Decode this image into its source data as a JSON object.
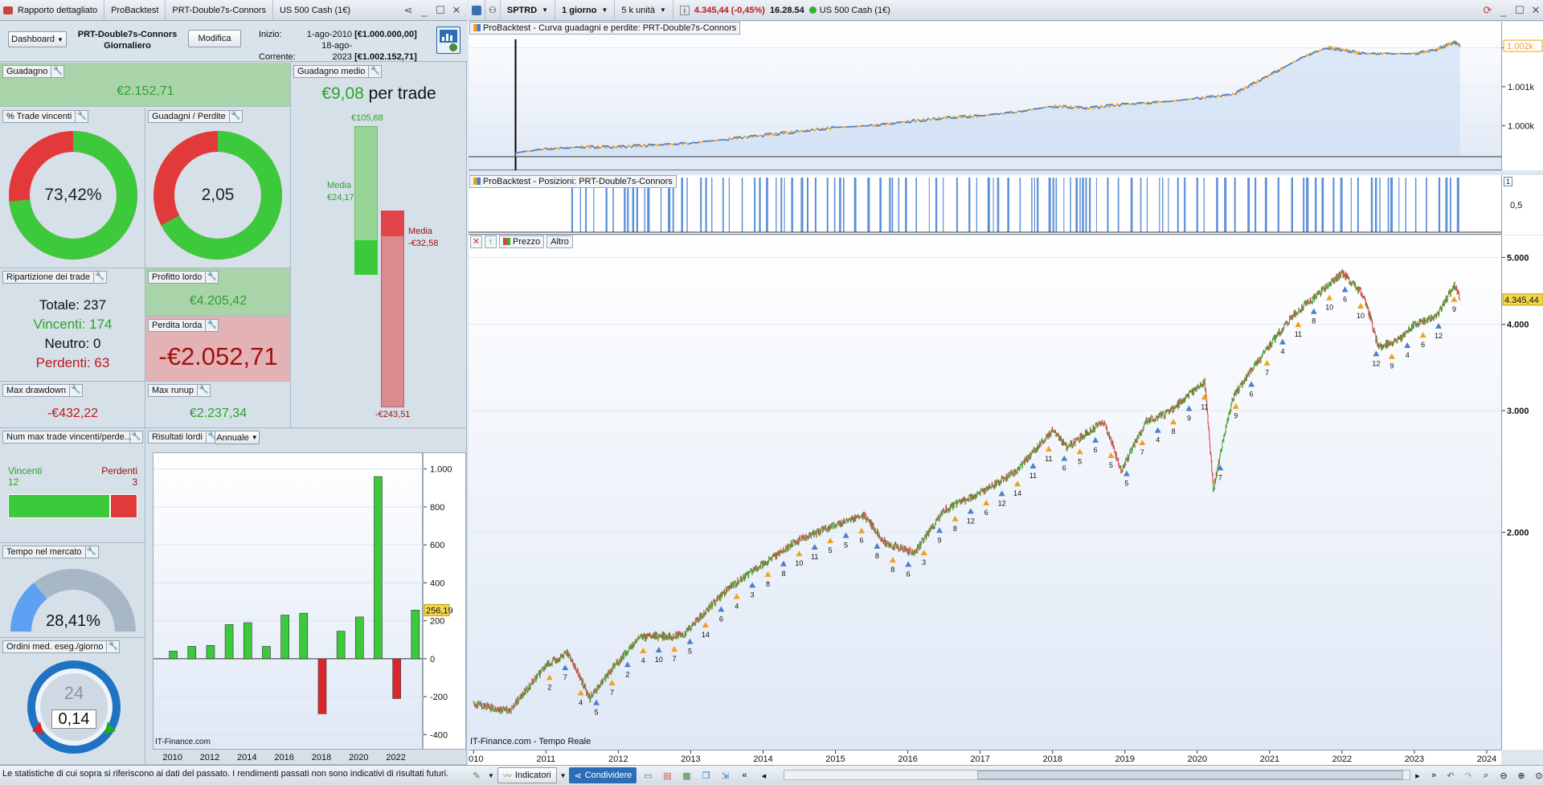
{
  "report_window": {
    "tabs": [
      "Rapporto dettagliato",
      "ProBacktest",
      "PRT-Double7s-Connors",
      "US 500 Cash (1€)"
    ],
    "dashboard_label": "Dashboard",
    "system_name": "PRT-Double7s-Connors",
    "timeframe": "Giornaliero",
    "modify_label": "Modifica",
    "start_label": "Inizio:",
    "start_date": "1-ago-2010",
    "start_capital": "[€1.000.000,00]",
    "current_label": "Corrente:",
    "current_date": "18-ago-2023",
    "current_capital": "[€1.002.152,71]"
  },
  "panels": {
    "guadagno": {
      "label": "Guadagno",
      "value": "€2.152,71"
    },
    "guadagno_medio": {
      "label": "Guadagno medio",
      "value": "€9,08",
      "suffix": "per trade",
      "max_gain": "€105,68",
      "media_label": "Media",
      "media_gain": "€24,17",
      "media_loss_label": "Media",
      "media_loss": "-€32,58",
      "max_loss": "-€243,51",
      "gain_fraction": 0.23,
      "loss_fraction": 0.13
    },
    "trade_vincenti": {
      "label": "% Trade vincenti",
      "value": "73,42%",
      "percent": 73.42
    },
    "guadagni_perdite": {
      "label": "Guadagni / Perdite",
      "value": "2,05",
      "ratio": 2.05
    },
    "ripartizione": {
      "label": "Ripartizione dei trade",
      "totale": "Totale: 237",
      "vincenti": "Vincenti: 174",
      "neutro": "Neutro: 0",
      "perdenti": "Perdenti: 63"
    },
    "profitto_lordo": {
      "label": "Profitto lordo",
      "value": "€4.205,42"
    },
    "perdita_lorda": {
      "label": "Perdita lorda",
      "value": "-€2.052,71"
    },
    "max_drawdown": {
      "label": "Max drawdown",
      "value": "-€432,22"
    },
    "max_runup": {
      "label": "Max runup",
      "value": "€2.237,34"
    },
    "num_max_trade": {
      "label": "Num max trade vincenti/perde...",
      "vincenti_label": "Vincenti",
      "vincenti_value": "12",
      "perdenti_label": "Perdenti",
      "perdenti_value": "3"
    },
    "tempo_mercato": {
      "label": "Tempo nel mercato",
      "value": "28,41%",
      "percent": 28.41
    },
    "ordini": {
      "label": "Ordini med. eseg./giorno",
      "hours": "24",
      "value": "0,14"
    },
    "risultati_lordi": {
      "label": "Risultati lordi",
      "period": "Annuale",
      "watermark": "IT-Finance.com",
      "current_value": "256,19"
    }
  },
  "footer_note": "Le statistiche di cui sopra si riferiscono ai dati del passato. I rendimenti passati non sono indicativi di risultati futuri.",
  "chart_data": [
    {
      "type": "bar",
      "title": "Risultati lordi",
      "categories": [
        "2010",
        "2011",
        "2012",
        "2013",
        "2014",
        "2015",
        "2016",
        "2017",
        "2018",
        "2019",
        "2020",
        "2021",
        "2022",
        "2023"
      ],
      "values": [
        40,
        65,
        70,
        180,
        190,
        65,
        230,
        240,
        -290,
        145,
        220,
        960,
        -210,
        256.19
      ],
      "x_tick_labels": [
        "2010",
        "2012",
        "2014",
        "2016",
        "2018",
        "2020",
        "2022"
      ],
      "y_tick_labels": [
        "1.000",
        "800",
        "600",
        "400",
        "200",
        "0",
        "-200",
        "-400"
      ],
      "ylim": [
        -420,
        1020
      ]
    },
    {
      "type": "line",
      "title": "ProBacktest - Curva guadagni e perdite: PRT-Double7s-Connors",
      "y_tick_labels": [
        "1.002k",
        "1.001k",
        "1.000k"
      ],
      "current_value": "1.002k",
      "x": [
        2010.58,
        2011,
        2011.5,
        2012,
        2012.5,
        2013,
        2013.5,
        2014,
        2014.5,
        2015,
        2015.5,
        2016,
        2016.5,
        2017,
        2017.5,
        2018,
        2018.5,
        2019,
        2019.5,
        2020,
        2020.5,
        2020.9,
        2021.2,
        2021.5,
        2021.8,
        2022,
        2022.3,
        2022.6,
        2023,
        2023.3,
        2023.55,
        2023.63
      ],
      "y": [
        999.3,
        999.4,
        999.45,
        999.45,
        999.5,
        999.55,
        999.65,
        999.75,
        999.85,
        999.95,
        1000.0,
        1000.1,
        1000.2,
        1000.25,
        1000.35,
        1000.5,
        1000.45,
        1000.55,
        1000.6,
        1000.7,
        1000.8,
        1001.2,
        1001.5,
        1001.8,
        1002.0,
        1001.95,
        1001.85,
        1001.85,
        1001.85,
        1001.95,
        1002.15,
        1002.05
      ],
      "ylim": [
        999.2,
        1002.3
      ]
    },
    {
      "type": "line",
      "title": "US 500 Cash (1€) SPTRD 1 giorno",
      "y_tick_labels": [
        "5.000",
        "4.000",
        "3.000",
        "2.000"
      ],
      "x_tick_labels": [
        "2010",
        "2011",
        "2012",
        "2013",
        "2014",
        "2015",
        "2016",
        "2017",
        "2018",
        "2019",
        "2020",
        "2021",
        "2022",
        "2023",
        "2024"
      ],
      "x": [
        2010.0,
        2010.5,
        2011.0,
        2011.3,
        2011.6,
        2012.0,
        2012.3,
        2012.9,
        2013.5,
        2014.0,
        2014.5,
        2015.0,
        2015.4,
        2015.7,
        2016.1,
        2016.5,
        2017.0,
        2017.5,
        2018.0,
        2018.2,
        2018.7,
        2018.95,
        2019.3,
        2019.6,
        2020.1,
        2020.22,
        2020.5,
        2020.9,
        2021.3,
        2021.7,
        2022.0,
        2022.3,
        2022.5,
        2022.8,
        2023.0,
        2023.3,
        2023.55,
        2023.63
      ],
      "y": [
        1130,
        1100,
        1280,
        1340,
        1150,
        1300,
        1410,
        1420,
        1650,
        1800,
        1950,
        2050,
        2110,
        1920,
        1870,
        2150,
        2280,
        2450,
        2800,
        2650,
        2900,
        2450,
        2900,
        2980,
        3300,
        2300,
        3150,
        3600,
        4100,
        4450,
        4750,
        4400,
        3700,
        3800,
        4000,
        4100,
        4550,
        4345
      ],
      "ylim": [
        1050,
        5100
      ],
      "current_value": "4.345,44"
    }
  ],
  "chart_window": {
    "symbol": "SPTRD",
    "timeframe": "1 giorno",
    "units": "5 k unità",
    "info_icon": "i",
    "price_change": "4.345,44 (-0,45%)",
    "time": "16.28.54",
    "instrument": "US 500 Cash (1€)",
    "equity_legend": "ProBacktest - Curva guadagni e perdite: PRT-Double7s-Connors",
    "positions_legend": "ProBacktest - Posizioni: PRT-Double7s-Connors",
    "positions_axis": [
      "1",
      "0,5"
    ],
    "price_legend": "Prezzo",
    "altro_label": "Altro",
    "watermark": "IT-Finance.com - Tempo Reale",
    "toolbar_indicators": "Indicatori",
    "toolbar_share": "Condividere",
    "signal_labels": [
      "2",
      "7",
      "4",
      "5",
      "7",
      "2",
      "4",
      "10",
      "7",
      "5",
      "14",
      "6",
      "4",
      "3",
      "8",
      "8",
      "10",
      "11",
      "5",
      "5",
      "6",
      "8",
      "8",
      "6",
      "3",
      "9",
      "8",
      "12",
      "6",
      "12",
      "14",
      "11",
      "11",
      "6",
      "5",
      "6",
      "5",
      "5",
      "7",
      "4",
      "8",
      "9",
      "11",
      "7",
      "9",
      "6",
      "7",
      "4",
      "11",
      "8",
      "10",
      "6",
      "10",
      "12",
      "9",
      "4",
      "6",
      "12",
      "9"
    ]
  }
}
